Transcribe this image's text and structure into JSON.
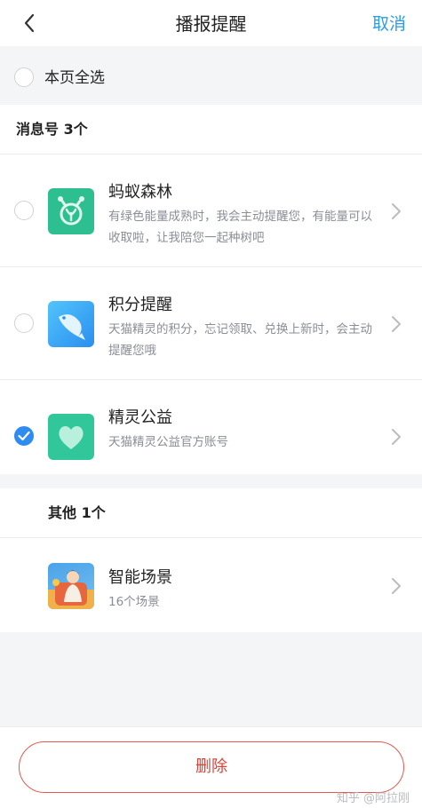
{
  "header": {
    "title": "播报提醒",
    "cancel_label": "取消"
  },
  "select_all": {
    "label": "本页全选"
  },
  "sections": [
    {
      "heading": "消息号 3个",
      "items": [
        {
          "title": "蚂蚁森林",
          "description": "有绿色能量成熟时，我会主动提醒您，有能量可以收取啦，让我陪您一起种树吧",
          "checked": false,
          "icon": "ant-forest-icon",
          "icon_color": "#2dbf8f"
        },
        {
          "title": "积分提醒",
          "description": "天猫精灵的积分，忘记领取、兑换上新时，会主动提醒您哦",
          "checked": false,
          "icon": "fish-points-icon",
          "icon_color": "#3aa8f5"
        },
        {
          "title": "精灵公益",
          "description": "天猫精灵公益官方账号",
          "checked": true,
          "icon": "heart-charity-icon",
          "icon_color": "#32c79a"
        }
      ]
    },
    {
      "heading": "其他 1个",
      "items": [
        {
          "title": "智能场景",
          "description": "16个场景",
          "icon": "smart-scene-icon"
        }
      ]
    }
  ],
  "footer": {
    "delete_label": "删除"
  },
  "watermark": "知乎 @阿拉刚",
  "colors": {
    "accent_blue": "#2d9be6",
    "delete_red": "#d9443a",
    "checkbox_blue": "#2e8cf0"
  }
}
